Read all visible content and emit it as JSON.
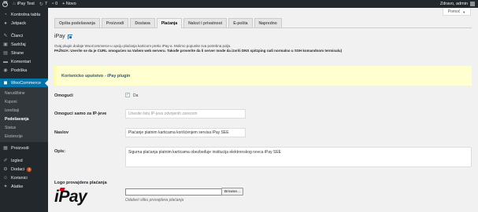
{
  "adminbar": {
    "site_name": "iPay Test",
    "updates_count": "7",
    "comments_count": "0",
    "new_label": "+ Novo",
    "greeting": "Zdravo, admin"
  },
  "sidebar": {
    "items": [
      {
        "label": "Kontrolna tabla",
        "icon": "dashboard-icon"
      },
      {
        "label": "Jetpack",
        "icon": "jetpack-icon"
      },
      {
        "label": "Članci",
        "icon": "pin-icon"
      },
      {
        "label": "Sadržaj",
        "icon": "media-icon"
      },
      {
        "label": "Strane",
        "icon": "page-icon"
      },
      {
        "label": "Komentari",
        "icon": "comment-icon"
      },
      {
        "label": "Podrška",
        "icon": "support-icon"
      },
      {
        "label": "WooCommerce",
        "icon": "woocommerce-icon"
      }
    ],
    "submenu": [
      "Narudžbine",
      "Kuponi",
      "Izveštaji",
      "Podešavanja",
      "Status",
      "Ekstenzije"
    ],
    "items_after": [
      {
        "label": "Proizvodi",
        "icon": "products-icon"
      },
      {
        "label": "Izgled",
        "icon": "appearance-icon"
      },
      {
        "label": "Dodaci",
        "icon": "plugins-icon",
        "badge": "3"
      },
      {
        "label": "Korisnici",
        "icon": "users-icon"
      },
      {
        "label": "Alatke",
        "icon": "tools-icon"
      }
    ]
  },
  "header": {
    "help_label": "Pomoć"
  },
  "tabs": [
    "Opšta podešavanja",
    "Proizvodi",
    "Dostava",
    "Plaćanja",
    "Nalozi i privatnost",
    "E-pošta",
    "Napredno"
  ],
  "section": {
    "title": "iPay",
    "description": "Ovaj plugin dodaje WooCommerce-u opciju plaćanja karticom preko iPay-a. Molimo popunite sva potrebna polja.",
    "warning": "PAŽNJA: Uverite se da je CURL omogućen na Vašem web serveru. Takođe proverite da li server mode da izvrši DNS spitzping radi normalno u SSH komandnom terminalu)"
  },
  "notice": {
    "link_text": "Korisnicko uputstvo - iPay plugin"
  },
  "form": {
    "enable_label": "Omogući",
    "enable_check_label": "Da",
    "ip_label": "Omoguci samo za IP-jeve",
    "ip_placeholder": "Unesite listu IP-jeva odvojenih zarezom",
    "title_label": "Naslov",
    "title_value": "Plaćanje platnim karticama korišćenjem servisa iPay SEE",
    "desc_label": "Opis:",
    "desc_value": "Sigurna plaćanja platnim karticama obezbeđuje institucija elektronskog novca iPay SEE",
    "logo_label": "Logo provajdera plaćanja",
    "logo_text": "iPay",
    "browse_label": "Browse...",
    "file_hint": "Odaberi sliku provajdera plaćanja"
  }
}
